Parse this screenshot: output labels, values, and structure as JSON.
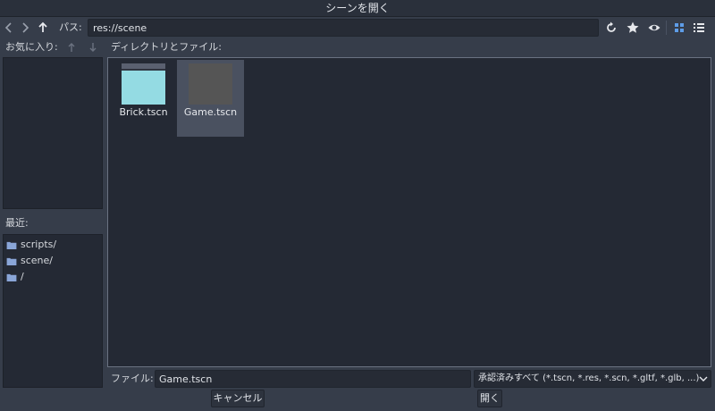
{
  "window": {
    "title": "シーンを開く"
  },
  "toolbar": {
    "back_icon": "chevron-left-icon",
    "forward_icon": "chevron-right-icon",
    "up_icon": "arrow-up-icon",
    "path_label": "パス:",
    "path_value": "res://scene",
    "refresh_icon": "refresh-icon",
    "favorite_icon": "star-icon",
    "hidden_icon": "eye-icon",
    "grid_view_icon": "grid-icon",
    "list_view_icon": "list-icon"
  },
  "favorites": {
    "label": "お気に入り:"
  },
  "directory": {
    "label": "ディレクトリとファイル:"
  },
  "recent": {
    "label": "最近:",
    "items": [
      {
        "label": "scripts/"
      },
      {
        "label": "scene/"
      },
      {
        "label": "/"
      }
    ]
  },
  "files": [
    {
      "name": "Brick.tscn",
      "thumb_color": "#94dbe3",
      "selected": false
    },
    {
      "name": "Game.tscn",
      "thumb_color": "#555555",
      "selected": true
    }
  ],
  "footer": {
    "file_label": "ファイル:",
    "file_value": "Game.tscn",
    "filter_value": "承認済みすべて (*.tscn, *.res, *.scn, *.gltf, *.glb, ...)",
    "cancel_label": "キャンセル",
    "open_label": "開く"
  },
  "colors": {
    "accent": "#5e9de8",
    "folder": "#8aa6d8",
    "background": "#363d4a",
    "panel": "#242934"
  }
}
